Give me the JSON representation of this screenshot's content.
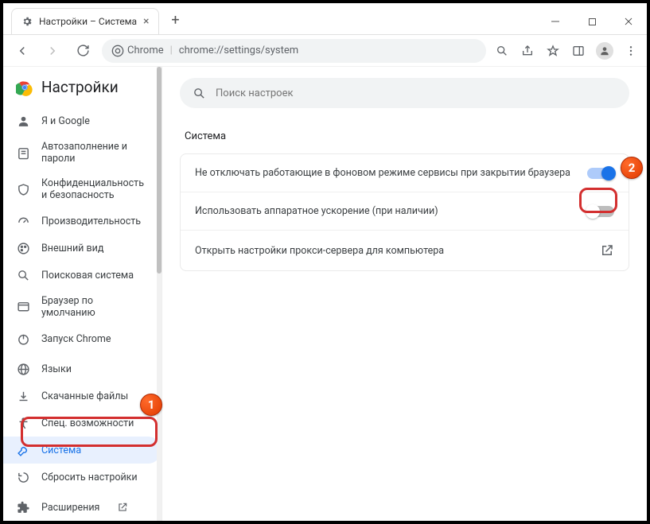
{
  "tab": {
    "title": "Настройки – Система"
  },
  "omnibox": {
    "app": "Chrome",
    "url": "chrome://settings/system"
  },
  "brand": "Настройки",
  "search": {
    "placeholder": "Поиск настроек"
  },
  "sidebar": {
    "items": [
      {
        "label": "Я и Google"
      },
      {
        "label": "Автозаполнение и пароли"
      },
      {
        "label": "Конфиденциальность и безопасность"
      },
      {
        "label": "Производительность"
      },
      {
        "label": "Внешний вид"
      },
      {
        "label": "Поисковая система"
      },
      {
        "label": "Браузер по умолчанию"
      },
      {
        "label": "Запуск Chrome"
      },
      {
        "label": "Языки"
      },
      {
        "label": "Скачанные файлы"
      },
      {
        "label": "Спец. возможности"
      },
      {
        "label": "Система"
      },
      {
        "label": "Сбросить настройки"
      },
      {
        "label": "Расширения"
      }
    ]
  },
  "section": {
    "title": "Система"
  },
  "rows": [
    {
      "label": "Не отключать работающие в фоновом режиме сервисы при закрытии браузера"
    },
    {
      "label": "Использовать аппаратное ускорение (при наличии)"
    },
    {
      "label": "Открыть настройки прокси-сервера для компьютера"
    }
  ],
  "annotations": {
    "one": "1",
    "two": "2"
  }
}
